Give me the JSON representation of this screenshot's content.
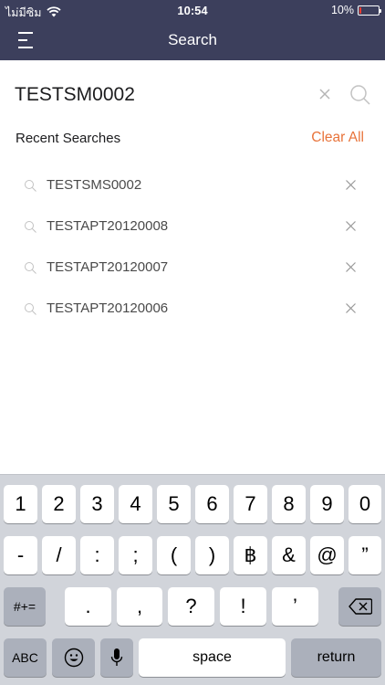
{
  "status_bar": {
    "carrier": "ไม่มีซิม",
    "time": "10:54",
    "battery_percent": "10%",
    "battery_level": 0.1,
    "battery_color": "#ff3b30"
  },
  "nav": {
    "title": "Search",
    "menu_icon": "menu-icon",
    "header_color": "#3c3f5c"
  },
  "search": {
    "query": "TESTSM0002",
    "clear_icon": "close-icon",
    "search_icon": "search-icon"
  },
  "recent": {
    "title": "Recent Searches",
    "clear_all_label": "Clear All",
    "accent_color": "#e8733a",
    "items": [
      {
        "label": "TESTSMS0002"
      },
      {
        "label": "TESTAPT20120008"
      },
      {
        "label": "TESTAPT20120007"
      },
      {
        "label": "TESTAPT20120006"
      }
    ]
  },
  "keyboard": {
    "row1": [
      "1",
      "2",
      "3",
      "4",
      "5",
      "6",
      "7",
      "8",
      "9",
      "0"
    ],
    "row2": [
      "-",
      "/",
      ":",
      ";",
      "(",
      ")",
      "฿",
      "&",
      "@",
      "”"
    ],
    "row3_toggle": "#+=",
    "row3": [
      ".",
      ",",
      "?",
      "!",
      "’"
    ],
    "backspace_icon": "backspace-icon",
    "abc_label": "ABC",
    "emoji_icon": "emoji-icon",
    "mic_icon": "microphone-icon",
    "space_label": "space",
    "return_label": "return"
  }
}
